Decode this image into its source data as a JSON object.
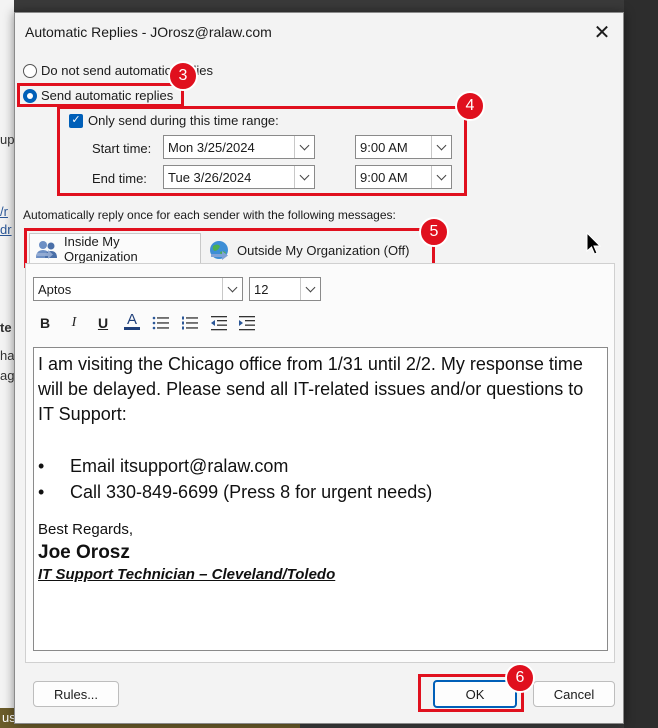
{
  "background": {
    "fragments": [
      "up",
      "/r",
      "dr",
      "te",
      "ha",
      "ag",
      "us"
    ]
  },
  "dialog": {
    "title": "Automatic Replies - JOrosz@ralaw.com",
    "close_glyph": "✕"
  },
  "options": {
    "do_not_send_label": "Do not send automatic replies",
    "send_label": "Send automatic replies",
    "time_range_label": "Only send during this time range:",
    "start_time_label": "Start time:",
    "end_time_label": "End time:",
    "start_date": "Mon 3/25/2024",
    "start_time": "9:00 AM",
    "end_date": "Tue 3/26/2024",
    "end_time": "9:00 AM"
  },
  "instruction": "Automatically reply once for each sender with the following messages:",
  "tabs": {
    "inside": "Inside My Organization",
    "outside": "Outside My Organization (Off)"
  },
  "formatting": {
    "font": "Aptos",
    "size": "12",
    "bold": "B",
    "italic": "I",
    "underline": "U",
    "font_color": "A"
  },
  "message": {
    "paragraph": "I am visiting the Chicago office from 1/31 until 2/2. My response time will be delayed. Please send all IT-related issues and/or questions to IT Support:",
    "bullet_glyph": "•",
    "bullets": [
      "Email itsupport@ralaw.com",
      "Call 330-849-6699 (Press 8 for urgent needs)"
    ],
    "regards": "Best Regards,",
    "name": "Joe Orosz",
    "title": "IT Support Technician – Cleveland/Toledo"
  },
  "buttons": {
    "rules": "Rules...",
    "ok": "OK",
    "cancel": "Cancel"
  },
  "annotations": {
    "step3": "3",
    "step4": "4",
    "step5": "5",
    "step6": "6"
  },
  "colors": {
    "accent": "#005fb8",
    "annotation_red": "#e0101e"
  }
}
